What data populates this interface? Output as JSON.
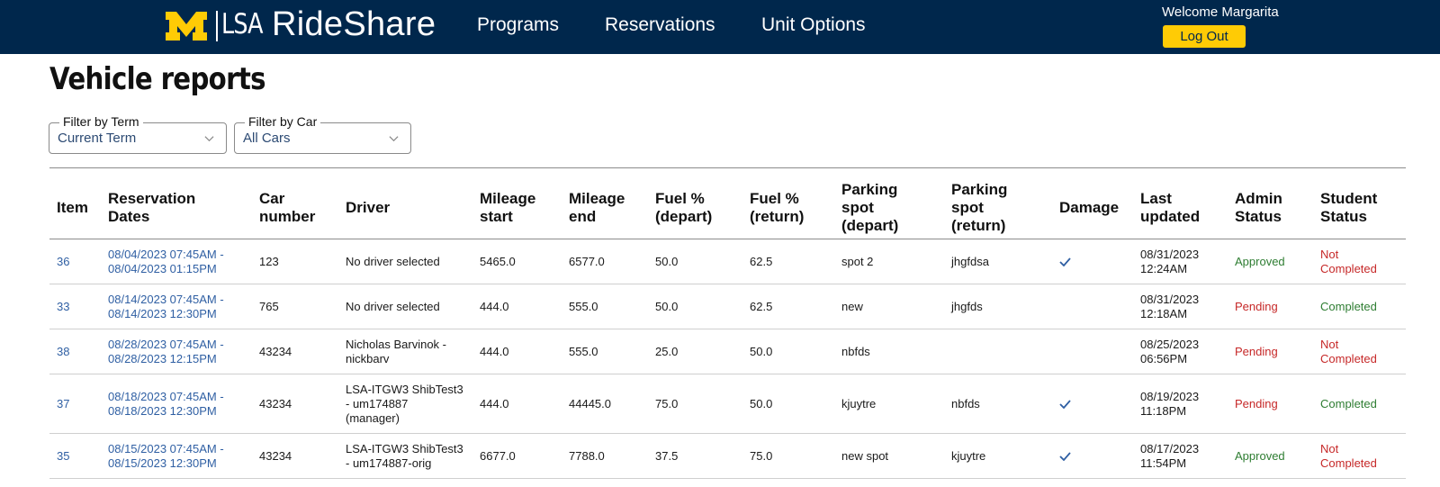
{
  "header": {
    "logo_m": "M",
    "logo_lsa": "LSA",
    "app_name": "RideShare",
    "nav": [
      "Programs",
      "Reservations",
      "Unit Options"
    ],
    "welcome": "Welcome Margarita",
    "logout_label": "Log Out",
    "brand_blue": "#00274c",
    "brand_maize": "#ffcb05"
  },
  "page": {
    "title": "Vehicle reports"
  },
  "filters": {
    "term": {
      "label": "Filter by Term",
      "value": "Current Term"
    },
    "car": {
      "label": "Filter by Car",
      "value": "All Cars"
    }
  },
  "table": {
    "columns": [
      [
        "Item"
      ],
      [
        "Reservation",
        "Dates"
      ],
      [
        "Car",
        "number"
      ],
      [
        "Driver"
      ],
      [
        "Mileage",
        "start"
      ],
      [
        "Mileage",
        "end"
      ],
      [
        "Fuel %",
        "(depart)"
      ],
      [
        "Fuel %",
        "(return)"
      ],
      [
        "Parking",
        "spot",
        "(depart)"
      ],
      [
        "Parking",
        "spot",
        "(return)"
      ],
      [
        "Damage"
      ],
      [
        "Last",
        "updated"
      ],
      [
        "Admin",
        "Status"
      ],
      [
        "Student",
        "Status"
      ]
    ],
    "rows": [
      {
        "item": "36",
        "dates": [
          "08/04/2023 07:45AM -",
          "08/04/2023 01:15PM"
        ],
        "car": "123",
        "driver": [
          "No driver selected"
        ],
        "mileage_start": "5465.0",
        "mileage_end": "6577.0",
        "fuel_depart": "50.0",
        "fuel_return": "62.5",
        "spot_depart": "spot 2",
        "spot_return": "jhgfdsa",
        "damage": true,
        "updated": [
          "08/31/2023",
          "12:24AM"
        ],
        "admin_status": "Approved",
        "student_status": [
          "Not",
          "Completed"
        ]
      },
      {
        "item": "33",
        "dates": [
          "08/14/2023 07:45AM -",
          "08/14/2023 12:30PM"
        ],
        "car": "765",
        "driver": [
          "No driver selected"
        ],
        "mileage_start": "444.0",
        "mileage_end": "555.0",
        "fuel_depart": "50.0",
        "fuel_return": "62.5",
        "spot_depart": "new",
        "spot_return": "jhgfds",
        "damage": false,
        "updated": [
          "08/31/2023",
          "12:18AM"
        ],
        "admin_status": "Pending",
        "student_status": [
          "Completed"
        ]
      },
      {
        "item": "38",
        "dates": [
          "08/28/2023 07:45AM -",
          "08/28/2023 12:15PM"
        ],
        "car": "43234",
        "driver": [
          "Nicholas Barvinok -",
          "nickbarv"
        ],
        "mileage_start": "444.0",
        "mileage_end": "555.0",
        "fuel_depart": "25.0",
        "fuel_return": "50.0",
        "spot_depart": "nbfds",
        "spot_return": "",
        "damage": false,
        "updated": [
          "08/25/2023",
          "06:56PM"
        ],
        "admin_status": "Pending",
        "student_status": [
          "Not",
          "Completed"
        ]
      },
      {
        "item": "37",
        "dates": [
          "08/18/2023 07:45AM -",
          "08/18/2023 12:30PM"
        ],
        "car": "43234",
        "driver": [
          "LSA-ITGW3 ShibTest3",
          "- um174887",
          "(manager)"
        ],
        "mileage_start": "444.0",
        "mileage_end": "44445.0",
        "fuel_depart": "75.0",
        "fuel_return": "50.0",
        "spot_depart": "kjuytre",
        "spot_return": "nbfds",
        "damage": true,
        "updated": [
          "08/19/2023",
          "11:18PM"
        ],
        "admin_status": "Pending",
        "student_status": [
          "Completed"
        ]
      },
      {
        "item": "35",
        "dates": [
          "08/15/2023 07:45AM -",
          "08/15/2023 12:30PM"
        ],
        "car": "43234",
        "driver": [
          "LSA-ITGW3 ShibTest3",
          "- um174887-orig"
        ],
        "mileage_start": "6677.0",
        "mileage_end": "7788.0",
        "fuel_depart": "37.5",
        "fuel_return": "75.0",
        "spot_depart": "new spot",
        "spot_return": "kjuytre",
        "damage": true,
        "updated": [
          "08/17/2023",
          "11:54PM"
        ],
        "admin_status": "Approved",
        "student_status": [
          "Not",
          "Completed"
        ]
      }
    ]
  },
  "status_colors": {
    "Approved": "#2e7d32",
    "Pending": "#c62828",
    "Completed": "#2e7d32",
    "Not Completed": "#c62828",
    "link": "#2f5fa3"
  },
  "icons": {
    "damage": "checkmark-icon",
    "dropdown": "chevron-down-icon"
  }
}
